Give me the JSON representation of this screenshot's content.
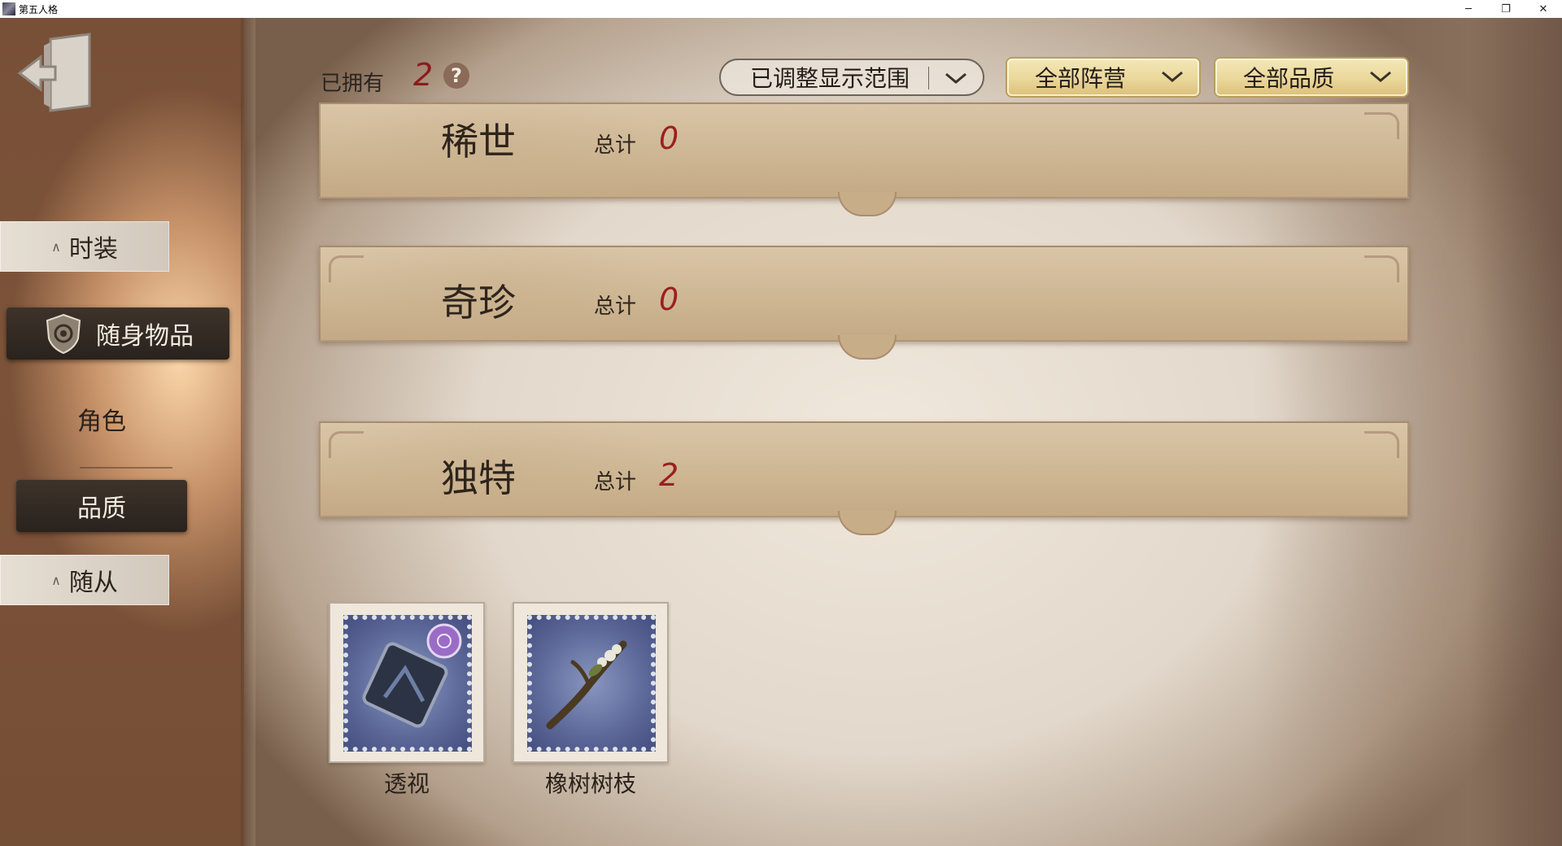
{
  "window": {
    "title": "第五人格",
    "controls": {
      "minimize": "─",
      "restore": "❐",
      "close": "✕"
    }
  },
  "sidebar": {
    "exit_icon": "exit-door-icon",
    "tab_top": {
      "label": "时装",
      "caret": "∧"
    },
    "items": [
      {
        "label": "随身物品",
        "icon": "shield-emblem-icon",
        "selected": true
      },
      {
        "label": "角色",
        "selected": false
      },
      {
        "label": "品质",
        "selected": true
      }
    ],
    "tab_bottom": {
      "label": "随从",
      "caret": "∧"
    }
  },
  "toolbar": {
    "owned_label": "已拥有",
    "owned_count": "2",
    "help_icon": "?",
    "range_dropdown": "已调整显示范围",
    "camp_dropdown": "全部阵营",
    "quality_dropdown": "全部品质"
  },
  "categories": [
    {
      "name": "稀世",
      "total_label": "总计",
      "total": "0"
    },
    {
      "name": "奇珍",
      "total_label": "总计",
      "total": "0"
    },
    {
      "name": "独特",
      "total_label": "总计",
      "total": "2"
    }
  ],
  "items": [
    {
      "name": "透视",
      "icon": "card-scope-icon"
    },
    {
      "name": "橡树树枝",
      "icon": "oak-branch-icon"
    }
  ],
  "colors": {
    "accent_red": "#9c1f1f",
    "gold_dropdown": "#ead79a",
    "selected_dark": "#2a221d"
  }
}
